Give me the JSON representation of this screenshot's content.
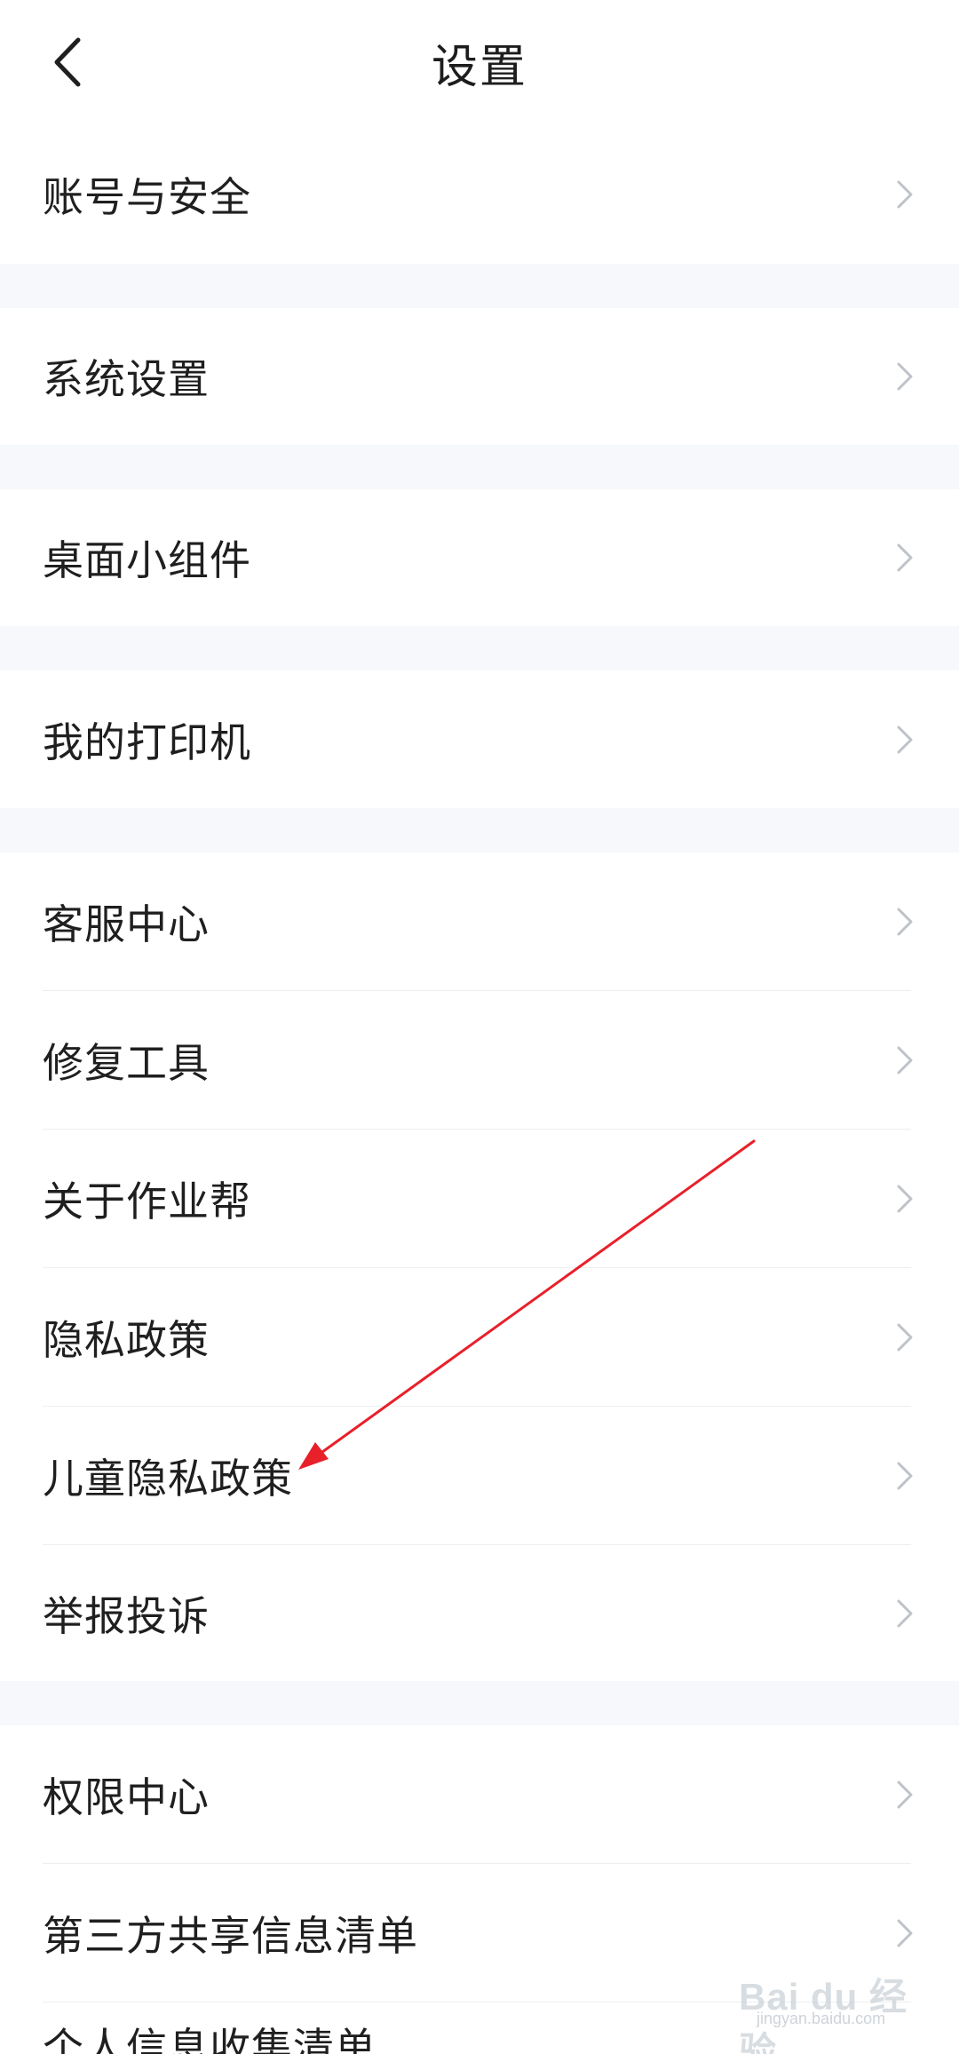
{
  "header": {
    "title": "设置",
    "back_icon": "chevron-left-icon"
  },
  "groups": [
    {
      "items": [
        {
          "label": "账号与安全"
        }
      ]
    },
    {
      "items": [
        {
          "label": "系统设置"
        }
      ]
    },
    {
      "items": [
        {
          "label": "桌面小组件"
        }
      ]
    },
    {
      "items": [
        {
          "label": "我的打印机"
        }
      ]
    },
    {
      "items": [
        {
          "label": "客服中心"
        },
        {
          "label": "修复工具"
        },
        {
          "label": "关于作业帮"
        },
        {
          "label": "隐私政策"
        },
        {
          "label": "儿童隐私政策"
        },
        {
          "label": "举报投诉"
        }
      ]
    },
    {
      "items": [
        {
          "label": "权限中心"
        },
        {
          "label": "第三方共享信息清单"
        },
        {
          "label": "个人信息收集清单"
        }
      ]
    }
  ],
  "colors": {
    "annotation_arrow": "#e8202a",
    "group_gap": "#f6f8fb",
    "chevron": "#bfc3c9"
  },
  "watermark": {
    "brand": "Bai du 经验",
    "url": "jingyan.baidu.com"
  }
}
